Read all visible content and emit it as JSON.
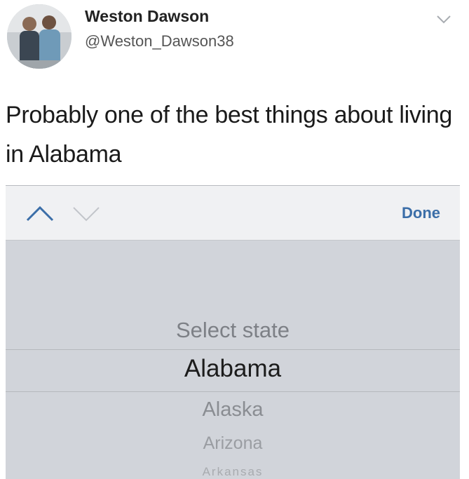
{
  "tweet": {
    "display_name": "Weston Dawson",
    "handle": "@Weston_Dawson38",
    "text": "Probably one of the best things about living in Alabama"
  },
  "picker": {
    "toolbar": {
      "up_icon": "chevron-up-icon",
      "down_icon": "chevron-down-icon",
      "done_label": "Done"
    },
    "options": [
      "Select state",
      "Alabama",
      "Alaska",
      "Arizona",
      "Arkansas"
    ],
    "selected": "Alabama"
  },
  "colors": {
    "done_blue": "#3b6ea8",
    "panel_gray": "#d1d4da",
    "toolbar_bg": "#f0f1f3"
  }
}
